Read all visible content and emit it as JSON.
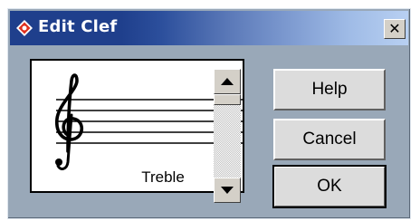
{
  "window": {
    "title": "Edit Clef",
    "close_glyph": "✕"
  },
  "preview": {
    "clef_name": "Treble",
    "clef_icon": "treble-clef-icon"
  },
  "scrollbar": {
    "up_icon": "arrow-up-icon",
    "down_icon": "arrow-down-icon"
  },
  "buttons": {
    "help": "Help",
    "cancel": "Cancel",
    "ok": "OK"
  },
  "colors": {
    "titlebar_dark": "#1f3f8c",
    "dialog_bg": "#99a8b8",
    "logo_red": "#e0301e"
  }
}
